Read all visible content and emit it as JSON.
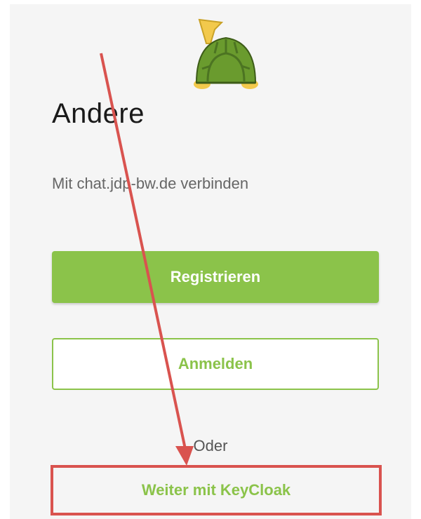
{
  "header": {
    "logo_icon": "turtle-logo-icon",
    "title": "Andere",
    "subtitle": "Mit chat.jdp-bw.de verbinden"
  },
  "actions": {
    "register_label": "Registrieren",
    "login_label": "Anmelden",
    "separator_label": "Oder",
    "keycloak_label": "Weiter mit KeyCloak"
  },
  "annotation": {
    "arrow_icon": "red-arrow-icon",
    "highlight_icon": "red-highlight-box",
    "color": "#d9534f"
  },
  "colors": {
    "accent": "#8bc34a",
    "background": "#f5f5f5"
  }
}
